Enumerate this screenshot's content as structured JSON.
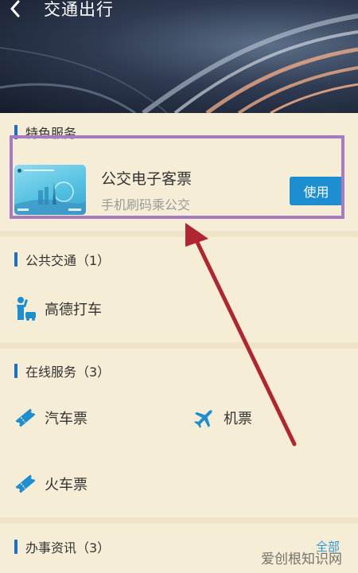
{
  "header": {
    "title": "交通出行"
  },
  "featured": {
    "section_title": "特色服务",
    "card_title": "公交电子客票",
    "card_subtitle": "手机刷码乘公交",
    "use_label": "使用"
  },
  "public_transport": {
    "section_title": "公共交通（1）",
    "items": [
      {
        "label": "高德打车",
        "icon": "taxi-person-icon"
      }
    ]
  },
  "online_services": {
    "section_title": "在线服务（3）",
    "items": [
      {
        "label": "汽车票",
        "icon": "ticket-icon"
      },
      {
        "label": "机票",
        "icon": "airplane-icon"
      },
      {
        "label": "火车票",
        "icon": "ticket-icon"
      }
    ]
  },
  "affairs": {
    "section_title": "办事资讯（3）",
    "more_label": "全部"
  },
  "watermark": "爱创根知识网",
  "colors": {
    "accent": "#1d8fd0",
    "section_bar": "#1e6fc2",
    "highlight": "#a77bc2",
    "arrow": "#b0252f",
    "background": "#f6edd7"
  }
}
